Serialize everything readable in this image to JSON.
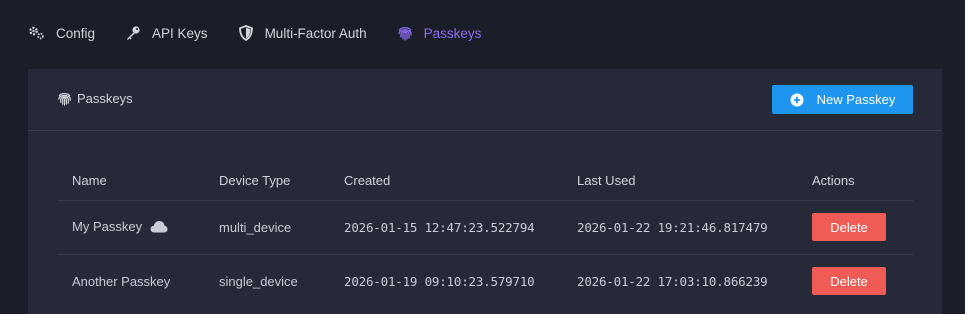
{
  "tabs": [
    {
      "label": "Config",
      "icon": "gears-icon",
      "active": false
    },
    {
      "label": "API Keys",
      "icon": "key-icon",
      "active": false
    },
    {
      "label": "Multi-Factor Auth",
      "icon": "shield-icon",
      "active": false
    },
    {
      "label": "Passkeys",
      "icon": "fingerprint-icon",
      "active": true
    }
  ],
  "card": {
    "title": "Passkeys",
    "title_icon": "fingerprint-icon",
    "new_button_label": "New Passkey",
    "new_button_icon": "plus-circle-icon"
  },
  "table": {
    "headers": [
      "Name",
      "Device Type",
      "Created",
      "Last Used",
      "Actions"
    ],
    "rows": [
      {
        "name": "My Passkey",
        "synced_icon": "cloud-icon",
        "device_type": "multi_device",
        "created": "2026-01-15 12:47:23.522794",
        "last_used": "2026-01-22 19:21:46.817479",
        "action_label": "Delete"
      },
      {
        "name": "Another Passkey",
        "device_type": "single_device",
        "created": "2026-01-19 09:10:23.579710",
        "last_used": "2026-01-22 17:03:10.866239",
        "action_label": "Delete"
      }
    ]
  },
  "colors": {
    "background": "#1b1d28",
    "card": "#262938",
    "accent": "#8c6cf5",
    "primary_button": "#1e96f0",
    "danger_button": "#f05c55"
  }
}
